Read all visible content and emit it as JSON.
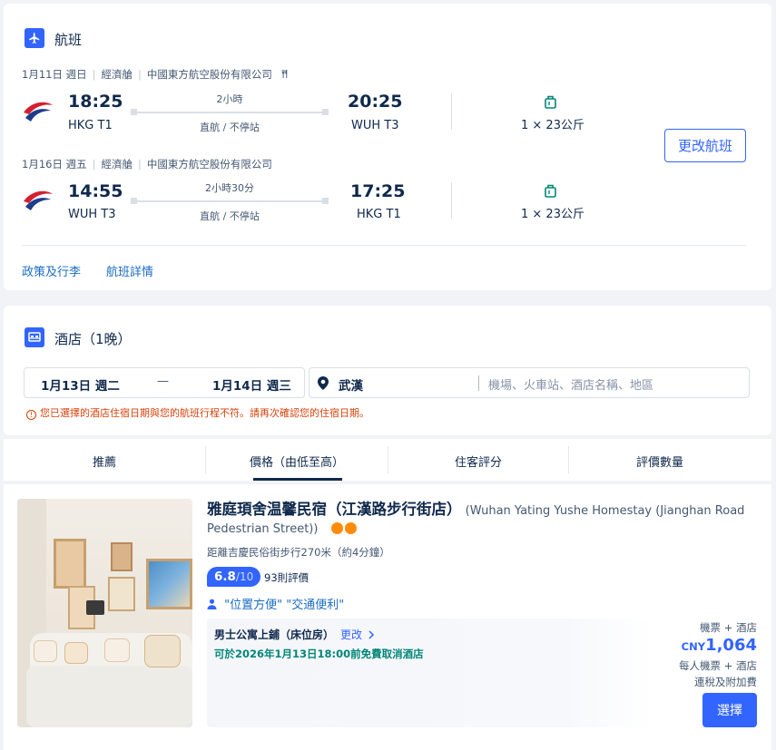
{
  "flight_section": {
    "title": "航班",
    "segments": [
      {
        "date": "1月11日 週日",
        "cabin": "經濟艙",
        "airline": "中國東方航空股份有限公司",
        "dep_time": "18:25",
        "dep_airport": "HKG T1",
        "duration": "2小時",
        "stops": "直航 / 不停站",
        "arr_time": "20:25",
        "arr_airport": "WUH T3",
        "baggage": "1 × 23公斤"
      },
      {
        "date": "1月16日 週五",
        "cabin": "經濟艙",
        "airline": "中國東方航空股份有限公司",
        "dep_time": "14:55",
        "dep_airport": "WUH T3",
        "duration": "2小時30分",
        "stops": "直航 / 不停站",
        "arr_time": "17:25",
        "arr_airport": "HKG T1",
        "baggage": "1 × 23公斤"
      }
    ],
    "change_button": "更改航班",
    "links": {
      "policy": "政策及行李",
      "details": "航班詳情"
    }
  },
  "hotel_section": {
    "title": "酒店（1晚）",
    "checkin": "1月13日 週二",
    "dash": "—",
    "checkout": "1月14日 週三",
    "city": "武漢",
    "search_placeholder": "機場、火車站、酒店名稱、地區",
    "warning": "您已選擇的酒店住宿日期與您的航班行程不符。請再次確認您的住宿日期。",
    "sort_tabs": [
      "推薦",
      "價格（由低至高）",
      "住客評分",
      "評價數量"
    ],
    "active_tab": 1,
    "hotel": {
      "name": "雅庭頊舍温馨民宿（江漢路步行街店）",
      "name_en_part1": "(Wuhan Yating Yushe Homestay (Jianghan Road",
      "name_en_part2": "Pedestrian Street))",
      "distance": "距離吉慶民俗街步行270米（約4分鐘）",
      "score": "6.8",
      "score_max": "/10",
      "reviews": "93則評價",
      "tags": "\"位置方便\" \"交通便利\"",
      "room": "男士公寓上鋪（床位房）",
      "room_change": "更改",
      "cancel": "可於2026年1月13日18:00前免費取消酒店",
      "price_label": "機票 + 酒店",
      "currency": "CNY",
      "price": "1,064",
      "per_person": "每人機票 + 酒店",
      "tax": "連稅及附加費",
      "select_button": "選擇"
    }
  },
  "colors": {
    "accent": "#3264ff",
    "warning": "#d6420b",
    "success": "#008577",
    "medal": "#ff8c00"
  }
}
